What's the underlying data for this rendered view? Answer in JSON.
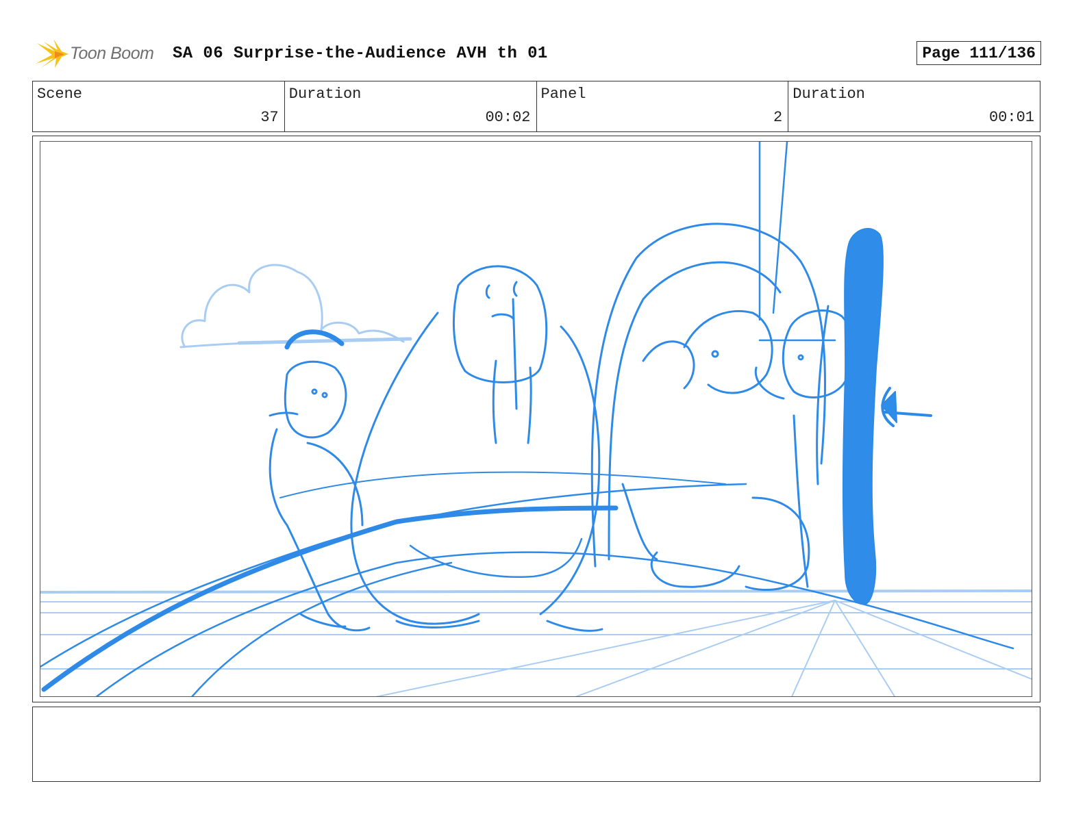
{
  "header": {
    "logo_text": "Toon Boom",
    "title": "SA 06 Surprise-the-Audience AVH th 01",
    "page": "Page 111/136"
  },
  "info": {
    "scene_label": "Scene",
    "scene_value": "37",
    "scene_duration_label": "Duration",
    "scene_duration_value": "00:02",
    "panel_label": "Panel",
    "panel_value": "2",
    "panel_duration_label": "Duration",
    "panel_duration_value": "00:01"
  },
  "panel": {
    "sketch_icon": "storyboard-sketch-walruses",
    "colors": {
      "sketch": "#2e8ae6",
      "sketch_light": "#a9cdf2",
      "fill": "#2f8ce8"
    }
  },
  "notes": {
    "text": ""
  }
}
